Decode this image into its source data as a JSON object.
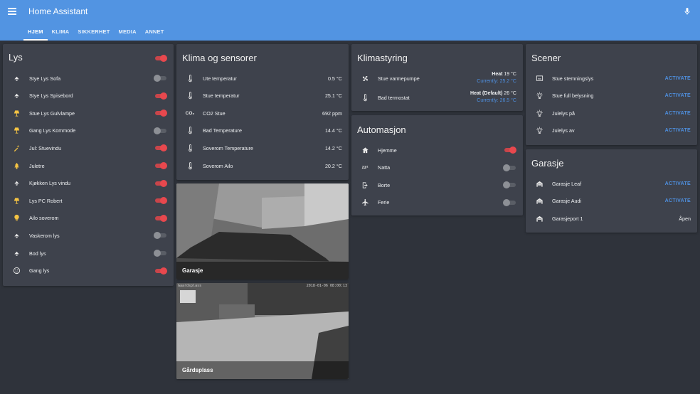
{
  "header": {
    "title": "Home Assistant",
    "tabs": [
      "HJEM",
      "KLIMA",
      "SIKKERHET",
      "MEDIA",
      "ANNET"
    ],
    "active_tab": "HJEM"
  },
  "colors": {
    "header": "#5294e2",
    "background": "#2f333b",
    "card": "#3e424c",
    "toggle_on": "#e8484e",
    "link": "#4e8fdf"
  },
  "lys": {
    "title": "Lys",
    "master_on": true,
    "items": [
      {
        "label": "Stye Lys Sofa",
        "icon": "ceiling-light-icon",
        "on": false
      },
      {
        "label": "Stye Lys Spisebord",
        "icon": "ceiling-light-icon",
        "on": true
      },
      {
        "label": "Stue Lys Gulvlampe",
        "icon": "lamp-icon",
        "on": true
      },
      {
        "label": "Gang Lys Kommode",
        "icon": "lamp-icon",
        "on": false
      },
      {
        "label": "Jul: Stuevindu",
        "icon": "star-wand-icon",
        "on": true
      },
      {
        "label": "Juletre",
        "icon": "pine-tree-icon",
        "on": true
      },
      {
        "label": "Kjøkken Lys vindu",
        "icon": "ceiling-light-icon",
        "on": true
      },
      {
        "label": "Lys PC Robert",
        "icon": "lamp-icon",
        "on": true
      },
      {
        "label": "Ailo soverom",
        "icon": "lightbulb-icon",
        "on": true
      },
      {
        "label": "Vaskerom lys",
        "icon": "ceiling-light-icon",
        "on": false
      },
      {
        "label": "Bod lys",
        "icon": "ceiling-light-icon",
        "on": false
      },
      {
        "label": "Gang lys",
        "icon": "motion-sensor-icon",
        "on": true
      }
    ]
  },
  "klima": {
    "title": "Klima og sensorer",
    "items": [
      {
        "label": "Ute temperatur",
        "value": "0.5 °C",
        "icon": "thermometer-icon"
      },
      {
        "label": "Stue temperatur",
        "value": "25.1 °C",
        "icon": "thermometer-icon"
      },
      {
        "label": "CO2 Stue",
        "value": "692 ppm",
        "icon": "co2-icon",
        "icon_text": "CO₂"
      },
      {
        "label": "Bad Temperature",
        "value": "14.4 °C",
        "icon": "thermometer-icon"
      },
      {
        "label": "Soverom Temperature",
        "value": "14.2 °C",
        "icon": "thermometer-icon"
      },
      {
        "label": "Soverom Ailo",
        "value": "20.2 °C",
        "icon": "thermometer-icon"
      }
    ]
  },
  "klimastyring": {
    "title": "Klimastyring",
    "items": [
      {
        "label": "Stue varmepumpe",
        "mode": "Heat",
        "target": "19 °C",
        "current": "Currently: 25.2 °C",
        "icon": "fan-icon"
      },
      {
        "label": "Bad termostat",
        "mode": "Heat (Default)",
        "target": "26 °C",
        "current": "Currently: 26.5 °C",
        "icon": "thermometer-icon"
      }
    ]
  },
  "automasjon": {
    "title": "Automasjon",
    "items": [
      {
        "label": "Hjemme",
        "icon": "home-icon",
        "on": true
      },
      {
        "label": "Natta",
        "icon": "sleep-icon",
        "icon_text": "zzᶻ",
        "on": false
      },
      {
        "label": "Borte",
        "icon": "exit-icon",
        "on": false
      },
      {
        "label": "Ferie",
        "icon": "airplane-icon",
        "on": false
      }
    ]
  },
  "scener": {
    "title": "Scener",
    "items": [
      {
        "label": "Stue stemningslys",
        "action": "ACTIVATE",
        "icon": "scene-icon"
      },
      {
        "label": "Stue full belysning",
        "action": "ACTIVATE",
        "icon": "lightbulb-on-icon"
      },
      {
        "label": "Julelys på",
        "action": "ACTIVATE",
        "icon": "lightbulb-on-icon"
      },
      {
        "label": "Julelys av",
        "action": "ACTIVATE",
        "icon": "lightbulb-on-icon"
      }
    ]
  },
  "garasje": {
    "title": "Garasje",
    "items": [
      {
        "label": "Garasje Leaf",
        "action": "ACTIVATE",
        "icon": "garage-icon"
      },
      {
        "label": "Garasje Audi",
        "action": "ACTIVATE",
        "icon": "garage-icon"
      },
      {
        "label": "Garasjeport 1",
        "value": "Åpen",
        "icon": "garage-open-icon"
      }
    ]
  },
  "cameras": [
    {
      "caption": "Garasje",
      "stamp": ""
    },
    {
      "caption": "Gårdsplass",
      "stamp_left": "Gaardsplass",
      "stamp": "2018-01-06 08:00:13"
    }
  ]
}
